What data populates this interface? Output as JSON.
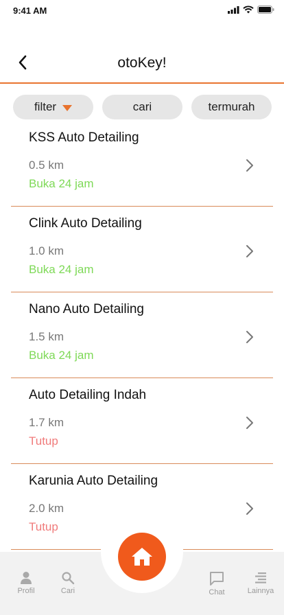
{
  "status_bar": {
    "time": "9:41 AM"
  },
  "header": {
    "title": "otoKey!"
  },
  "filters": {
    "filter_label": "filter",
    "cari_label": "cari",
    "termurah_label": "termurah"
  },
  "shops": [
    {
      "name": "KSS Auto Detailing",
      "distance": "0.5 km",
      "status": "Buka 24 jam",
      "open": true
    },
    {
      "name": "Clink Auto Detailing",
      "distance": "1.0 km",
      "status": "Buka 24 jam",
      "open": true
    },
    {
      "name": "Nano Auto Detailing",
      "distance": "1.5 km",
      "status": "Buka 24 jam",
      "open": true
    },
    {
      "name": "Auto Detailing Indah",
      "distance": "1.7 km",
      "status": "Tutup",
      "open": false
    },
    {
      "name": "Karunia Auto Detailing",
      "distance": "2.0 km",
      "status": "Tutup",
      "open": false
    }
  ],
  "bottom_nav": {
    "profil": "Profil",
    "cari": "Cari",
    "chat": "Chat",
    "lainnya": "Lainnya"
  },
  "colors": {
    "accent": "#e8732e",
    "home": "#f05a1c",
    "open": "#7ed957",
    "closed": "#f07b7b"
  }
}
